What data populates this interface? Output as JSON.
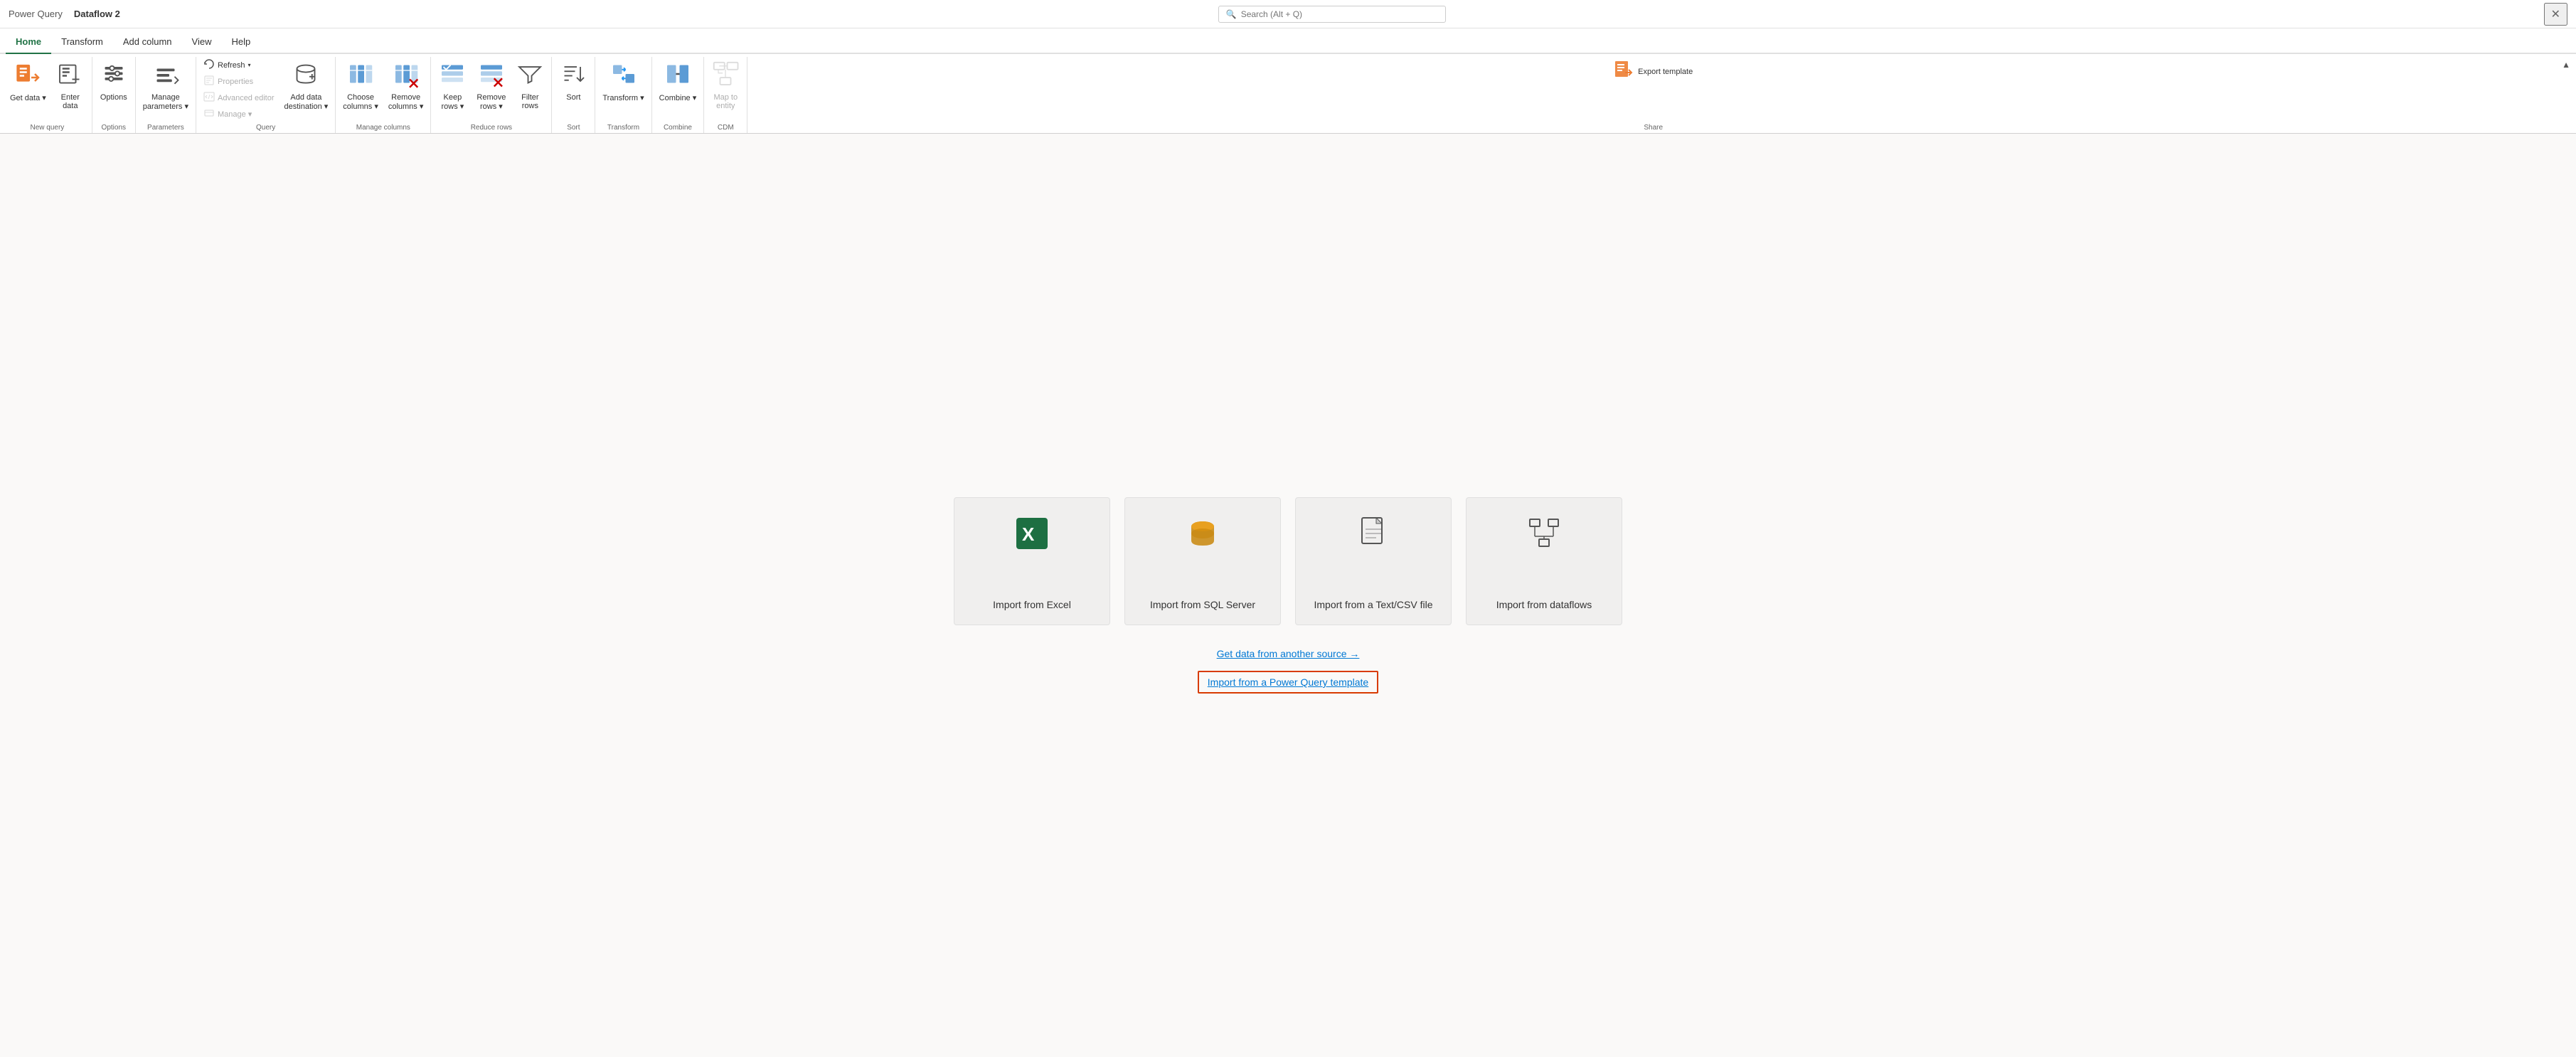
{
  "titleBar": {
    "appName": "Power Query",
    "docName": "Dataflow 2",
    "search": {
      "placeholder": "Search (Alt + Q)"
    },
    "close": "✕"
  },
  "tabs": [
    {
      "label": "Home",
      "active": true
    },
    {
      "label": "Transform",
      "active": false
    },
    {
      "label": "Add column",
      "active": false
    },
    {
      "label": "View",
      "active": false
    },
    {
      "label": "Help",
      "active": false
    }
  ],
  "ribbon": {
    "groups": [
      {
        "label": "New query",
        "items": [
          {
            "type": "large",
            "icon": "get-data",
            "label": "Get\ndata ∨"
          },
          {
            "type": "large",
            "icon": "enter-data",
            "label": "Enter\ndata"
          }
        ]
      },
      {
        "label": "Options",
        "items": [
          {
            "type": "large",
            "icon": "options",
            "label": "Options"
          }
        ]
      },
      {
        "label": "Parameters",
        "items": [
          {
            "type": "large",
            "icon": "manage-params",
            "label": "Manage\nparameters ∨"
          }
        ]
      },
      {
        "label": "Query",
        "items": [
          {
            "type": "small-col",
            "buttons": [
              {
                "label": "Refresh",
                "icon": "refresh",
                "disabled": false
              },
              {
                "label": "Properties",
                "icon": "properties",
                "disabled": true
              },
              {
                "label": "Advanced editor",
                "icon": "advanced-editor",
                "disabled": true
              },
              {
                "label": "Manage ∨",
                "icon": "manage",
                "disabled": true
              }
            ]
          },
          {
            "type": "large",
            "icon": "add-data-dest",
            "label": "Add data\ndestination ∨"
          }
        ]
      },
      {
        "label": "Manage columns",
        "items": [
          {
            "type": "large",
            "icon": "choose-cols",
            "label": "Choose\ncolumns ∨"
          },
          {
            "type": "large",
            "icon": "remove-cols",
            "label": "Remove\ncolumns ∨"
          }
        ]
      },
      {
        "label": "Reduce rows",
        "items": [
          {
            "type": "large",
            "icon": "keep-rows",
            "label": "Keep\nrows ∨"
          },
          {
            "type": "large",
            "icon": "remove-rows",
            "label": "Remove\nrows ∨"
          },
          {
            "type": "large",
            "icon": "filter-rows",
            "label": "Filter\nrows"
          }
        ]
      },
      {
        "label": "Sort",
        "items": [
          {
            "type": "large",
            "icon": "sort",
            "label": "Sort"
          }
        ]
      },
      {
        "label": "Transform",
        "items": [
          {
            "type": "large",
            "icon": "transform",
            "label": "Transform\n∨"
          }
        ]
      },
      {
        "label": "Combine",
        "items": [
          {
            "type": "large",
            "icon": "combine",
            "label": "Combine\n∨"
          }
        ]
      },
      {
        "label": "CDM",
        "items": [
          {
            "type": "large",
            "icon": "map-entity",
            "label": "Map to\nentity",
            "disabled": true
          }
        ]
      },
      {
        "label": "Share",
        "items": [
          {
            "type": "large",
            "icon": "export-template",
            "label": "Export template"
          }
        ]
      }
    ]
  },
  "main": {
    "importCards": [
      {
        "id": "excel",
        "icon": "excel",
        "label": "Import from Excel"
      },
      {
        "id": "sql",
        "icon": "sql",
        "label": "Import from SQL Server"
      },
      {
        "id": "textcsv",
        "icon": "textcsv",
        "label": "Import from a Text/CSV file"
      },
      {
        "id": "dataflows",
        "icon": "dataflows",
        "label": "Import from dataflows"
      }
    ],
    "getDataLink": "Get data from another source →",
    "templateLink": "Import from a Power Query template"
  }
}
